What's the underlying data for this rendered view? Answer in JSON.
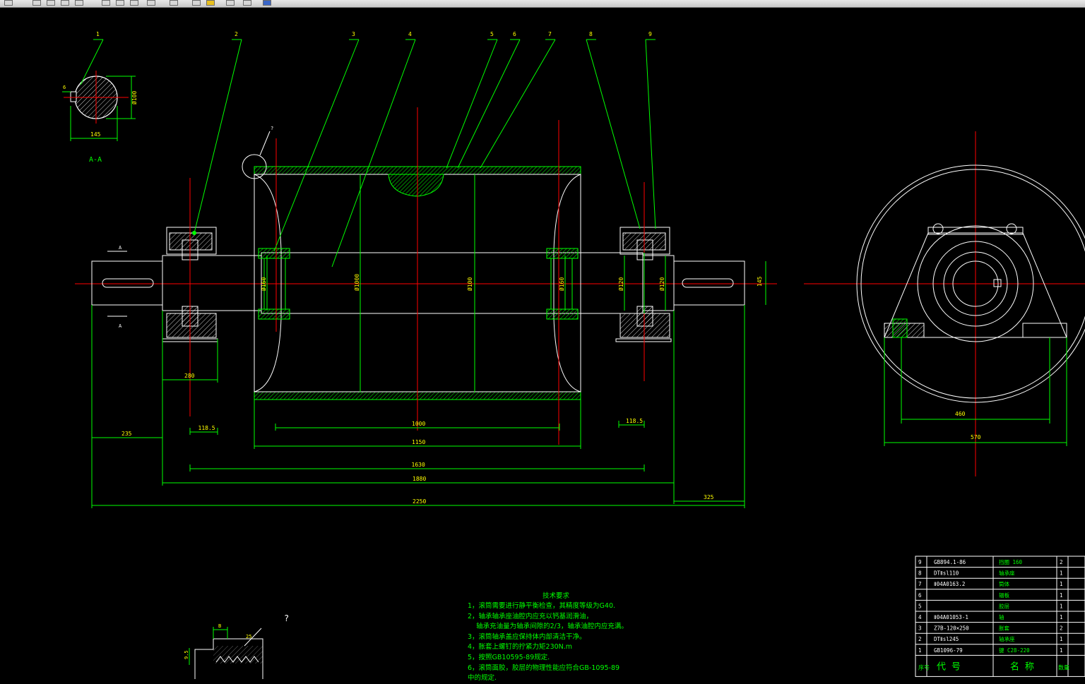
{
  "toolbar": {
    "buttons": [
      "print-icon",
      "pan-icon",
      "zoom-realtime-icon",
      "zoom-window-icon",
      "zoom-previous-icon",
      "zoom-in-icon",
      "zoom-out-icon",
      "zoom-extents-icon",
      "properties-icon",
      "design-center-icon",
      "tool-palette-icon",
      "sheet-set-icon",
      "markup-icon",
      "calc-icon",
      "help-icon"
    ]
  },
  "colors": {
    "background": "#000000",
    "green": "#00ff00",
    "red": "#ff0000",
    "white": "#ffffff",
    "cyan": "#00ffff"
  },
  "section": {
    "label": "A-A",
    "dim_width": "145",
    "dim_keyway": "Ø100",
    "key_label": "6"
  },
  "balloons": [
    "1",
    "2",
    "3",
    "4",
    "5",
    "6",
    "7",
    "8",
    "9"
  ],
  "detail_marker": "?",
  "section_marker": "A",
  "dims": {
    "shaft_dia": "Ø100",
    "drum_dia": "Ø1000",
    "hub_dia_left": "Ø160",
    "hub_dia_right": "Ø160",
    "bearing_left": "Ø120",
    "bearing_right": "Ø120",
    "shaft_end": "145",
    "housing_w": "280",
    "offset_left": "118.5",
    "offset_right": "118.5",
    "shaft_left": "235",
    "shaft_right": "325",
    "face": "1000",
    "drum_len": "1150",
    "bearing_span": "1630",
    "total_inner": "1880",
    "total": "2250",
    "end_base": "460",
    "end_total": "570"
  },
  "lagging": {
    "dim_b": "B",
    "dim_h": "9.5",
    "angle": "25",
    "marker": "?"
  },
  "requirements": {
    "title": "技术要求",
    "lines": [
      "1，滚筒需要进行静平衡检查，其精度等级为G40.",
      "2，轴承轴承座油腔内应充以钙基润滑油，",
      "    轴承充油量为轴承间隙的2/3，轴承油腔内应充满。",
      "3，滚筒轴承盖应保持体内部清洁干净。",
      "4，胀套上螺钉的拧紧力矩230N.m",
      "5，按照GB10595-89规定.",
      "6，滚筒面胶，胶层的物理性能应符合GB-1095-89",
      "中的规定."
    ]
  },
  "bom": {
    "rows": [
      {
        "no": "9",
        "code": "GB894.1-86",
        "name": "挡圈 160",
        "qty": "2"
      },
      {
        "no": "8",
        "code": "DTⅡsl110",
        "name": "轴承座",
        "qty": "1"
      },
      {
        "no": "7",
        "code": "Ⅱ04A0163.2",
        "name": "筒体",
        "qty": "1"
      },
      {
        "no": "6",
        "code": "",
        "name": "辐板",
        "qty": "1"
      },
      {
        "no": "5",
        "code": "",
        "name": "胶层",
        "qty": "1"
      },
      {
        "no": "4",
        "code": "Ⅱ04A01053-1",
        "name": "轴",
        "qty": "1"
      },
      {
        "no": "3",
        "code": "Z7B-120×250",
        "name": "胀套",
        "qty": "2"
      },
      {
        "no": "2",
        "code": "DTⅡsl245",
        "name": "轴承座",
        "qty": "1"
      },
      {
        "no": "1",
        "code": "GB1096-79",
        "name": "键 C28-220",
        "qty": "1"
      }
    ],
    "header": {
      "no": "序号",
      "code": "代 号",
      "name": "名 称",
      "qty": "数量"
    }
  }
}
